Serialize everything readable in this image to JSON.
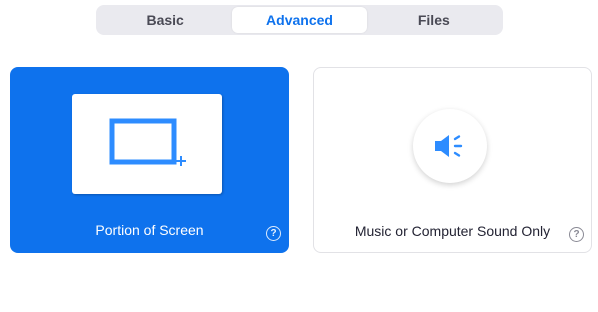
{
  "tabs": [
    {
      "label": "Basic",
      "active": false
    },
    {
      "label": "Advanced",
      "active": true
    },
    {
      "label": "Files",
      "active": false
    }
  ],
  "options": {
    "portion_of_screen": {
      "label": "Portion of Screen",
      "selected": true,
      "icon": "screen-region-icon"
    },
    "computer_sound": {
      "label": "Music or Computer Sound Only",
      "selected": false,
      "icon": "speaker-icon"
    }
  },
  "help_glyph": "?",
  "colors": {
    "accent": "#0e72ed",
    "tabbar_bg": "#eaeaef",
    "text_dark": "#232333"
  }
}
